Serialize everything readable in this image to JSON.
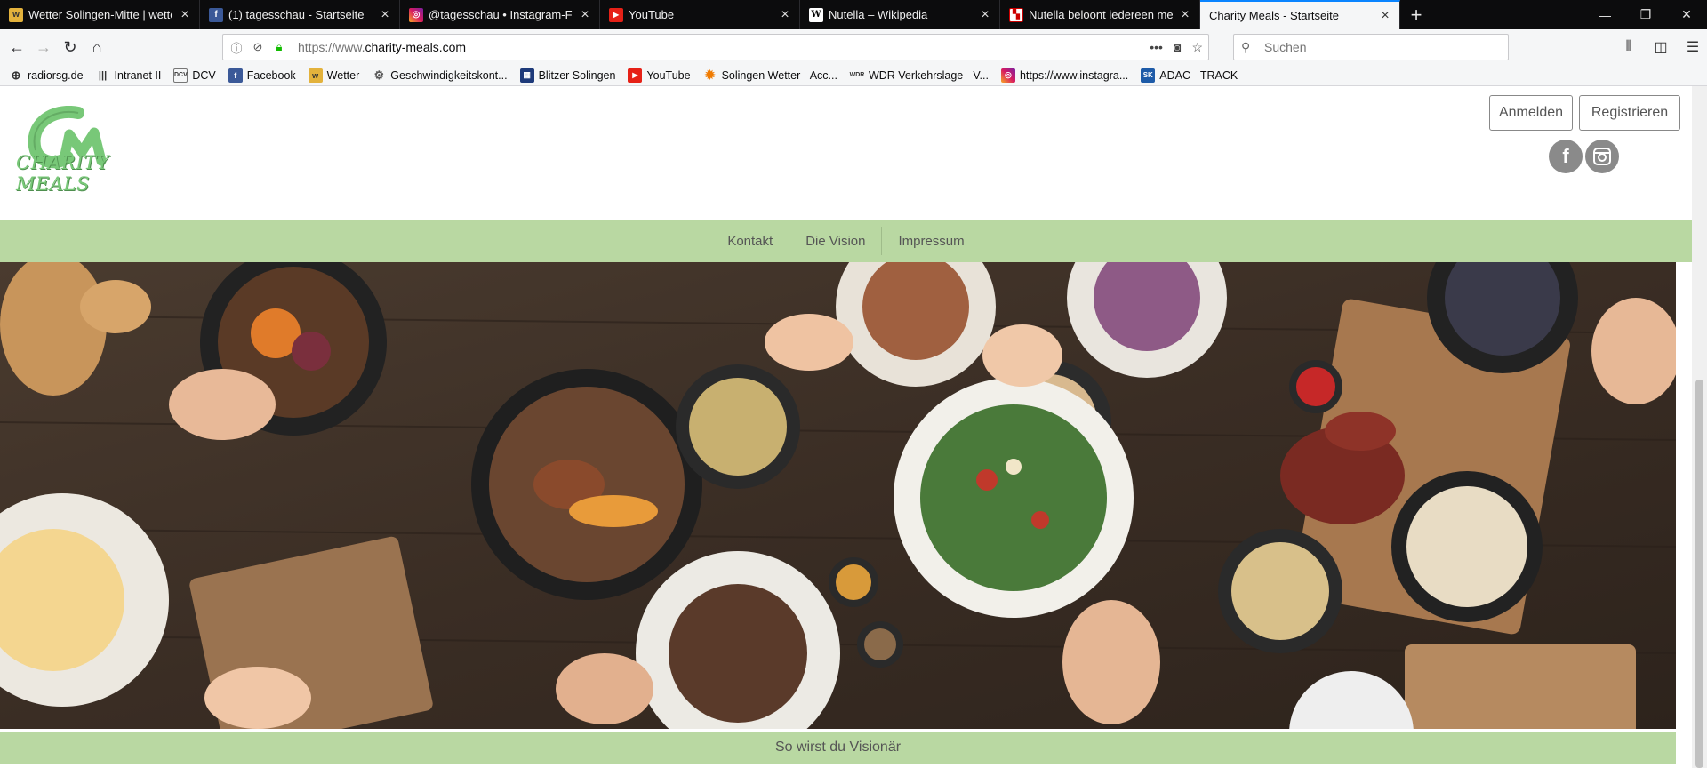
{
  "browser": {
    "tabs": [
      {
        "title": "Wetter Solingen-Mitte | wetter.",
        "favicon": "wetter-icon",
        "active": false
      },
      {
        "title": "(1) tagesschau - Startseite",
        "favicon": "facebook-icon",
        "active": false
      },
      {
        "title": "@tagesschau • Instagram-Foto",
        "favicon": "instagram-icon",
        "active": false
      },
      {
        "title": "YouTube",
        "favicon": "youtube-icon",
        "active": false
      },
      {
        "title": "Nutella – Wikipedia",
        "favicon": "wikipedia-icon",
        "active": false
      },
      {
        "title": "Nutella beloont iedereen met e",
        "favicon": "news-icon",
        "active": false
      },
      {
        "title": "Charity Meals - Startseite",
        "favicon": "",
        "active": true
      }
    ],
    "url_prefix": "https://www.",
    "url_domain": "charity-meals.com",
    "search_placeholder": "Suchen",
    "bookmarks": [
      {
        "label": "radiorsg.de",
        "icon": "globe-icon"
      },
      {
        "label": "Intranet II",
        "icon": "intranet-icon"
      },
      {
        "label": "DCV",
        "icon": "dcv-icon"
      },
      {
        "label": "Facebook",
        "icon": "facebook-icon"
      },
      {
        "label": "Wetter",
        "icon": "wetter-icon"
      },
      {
        "label": "Geschwindigkeitskont...",
        "icon": "gear-icon"
      },
      {
        "label": "Blitzer Solingen",
        "icon": "blitzer-icon"
      },
      {
        "label": "YouTube",
        "icon": "youtube-icon"
      },
      {
        "label": "Solingen Wetter - Acc...",
        "icon": "sun-icon"
      },
      {
        "label": "WDR Verkehrslage - V...",
        "icon": "wdr-icon"
      },
      {
        "label": "https://www.instagra...",
        "icon": "instagram-icon"
      },
      {
        "label": "ADAC - TRACK",
        "icon": "adac-icon"
      }
    ]
  },
  "site": {
    "logo_text": "CHARITY MEALS",
    "login_label": "Anmelden",
    "register_label": "Registrieren",
    "social_facebook": "f",
    "nav": [
      "Kontakt",
      "Die Vision",
      "Impressum"
    ],
    "vision_text": "So wirst du Visionär",
    "accent_green": "#b9d8a2",
    "logo_green": "#78c878"
  }
}
